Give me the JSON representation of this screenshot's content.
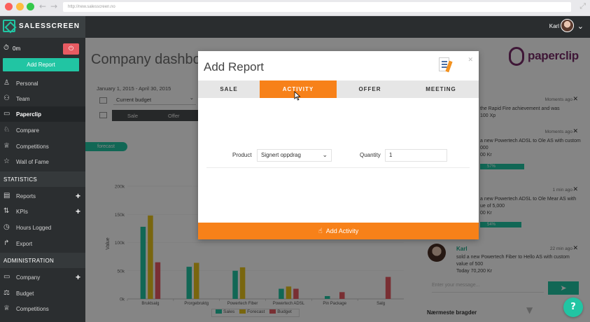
{
  "browser": {
    "url": "http://new.salesscreen.no"
  },
  "header": {
    "logo_text": "SALESSCREEN",
    "user_name": "Karl"
  },
  "sidebar": {
    "timer": "0m",
    "add_report_label": "Add Report",
    "items": [
      {
        "label": "Personal",
        "icon": "person-icon"
      },
      {
        "label": "Team",
        "icon": "team-icon"
      },
      {
        "label": "Paperclip",
        "icon": "briefcase-icon"
      },
      {
        "label": "Compare",
        "icon": "compare-icon"
      },
      {
        "label": "Competitions",
        "icon": "trophy-icon"
      },
      {
        "label": "Wall of Fame",
        "icon": "star-icon"
      }
    ],
    "statistics_header": "STATISTICS",
    "statistics_items": [
      {
        "label": "Reports",
        "icon": "reports-icon"
      },
      {
        "label": "KPIs",
        "icon": "kpi-icon"
      },
      {
        "label": "Hours Logged",
        "icon": "clock-icon"
      },
      {
        "label": "Export",
        "icon": "export-icon"
      }
    ],
    "administration_header": "ADMINISTRATION",
    "administration_items": [
      {
        "label": "Company",
        "icon": "company-icon"
      },
      {
        "label": "Budget",
        "icon": "scale-icon"
      },
      {
        "label": "Competitions",
        "icon": "trophy-icon"
      }
    ]
  },
  "main": {
    "page_title": "Company dashbo",
    "date_range": "January 1, 2015 - April 30, 2015",
    "budget_select": "Current budget",
    "tabs": [
      "Sale",
      "Offer"
    ],
    "forecast_label": "forecast",
    "brand_logo": "paperclip"
  },
  "chart_data": {
    "type": "bar",
    "categories": [
      "Bruktsalg",
      "Prorgebruktg",
      "Powertech Fiber",
      "Powertech ADSL",
      "Pin Package",
      "Salg"
    ],
    "series": [
      {
        "name": "Sales",
        "values": [
          128000,
          57000,
          50000,
          18000,
          5000,
          0
        ]
      },
      {
        "name": "Forecast",
        "values": [
          148000,
          64000,
          56000,
          22000,
          0,
          0
        ]
      },
      {
        "name": "Budget",
        "values": [
          65000,
          0,
          0,
          18000,
          12000,
          39000
        ]
      }
    ],
    "ylabel": "Value",
    "yticks": [
      "0k",
      "50k",
      "100k",
      "150k",
      "200k"
    ],
    "ylim": [
      0,
      200000
    ],
    "colors": {
      "Sales": "#21c5a3",
      "Forecast": "#e8c31c",
      "Budget": "#e85b62"
    },
    "legend": [
      "Sales",
      "Forecast",
      "Budget"
    ]
  },
  "feed": {
    "items": [
      {
        "time": "Moments ago",
        "text": [
          "the Rapid Fire achievement and was",
          "100 Xp"
        ]
      },
      {
        "time": "Moments ago",
        "text": [
          "a new Powertech ADSL to Ole AS with custom",
          "000",
          "00 Kr"
        ],
        "progress": "57%"
      },
      {
        "time": "1 min ago",
        "text": [
          "a new Powertech ADSL to Ole Mear AS with",
          "ue of 5,000",
          "00 Kr"
        ],
        "progress": "54%"
      },
      {
        "time": "22 min ago",
        "text": [
          "sold a new Powertech Fiber to Hello AS with custom",
          "value of 500",
          "Today 70,200 Kr"
        ]
      }
    ],
    "karl_name": "Karl",
    "message_placeholder": "Enter your message...",
    "nearest_label": "Nærmeste bragder"
  },
  "modal": {
    "title": "Add Report",
    "tabs": [
      "SALE",
      "ACTIVITY",
      "OFFER",
      "MEETING"
    ],
    "active_tab": "ACTIVITY",
    "product_label": "Product",
    "product_value": "Signert oppdrag",
    "quantity_label": "Quantity",
    "quantity_value": "1",
    "submit_label": "Add Activity"
  },
  "colors": {
    "accent": "#21c5a3",
    "orange": "#f78119",
    "sidebar_bg": "#2b2e30"
  }
}
